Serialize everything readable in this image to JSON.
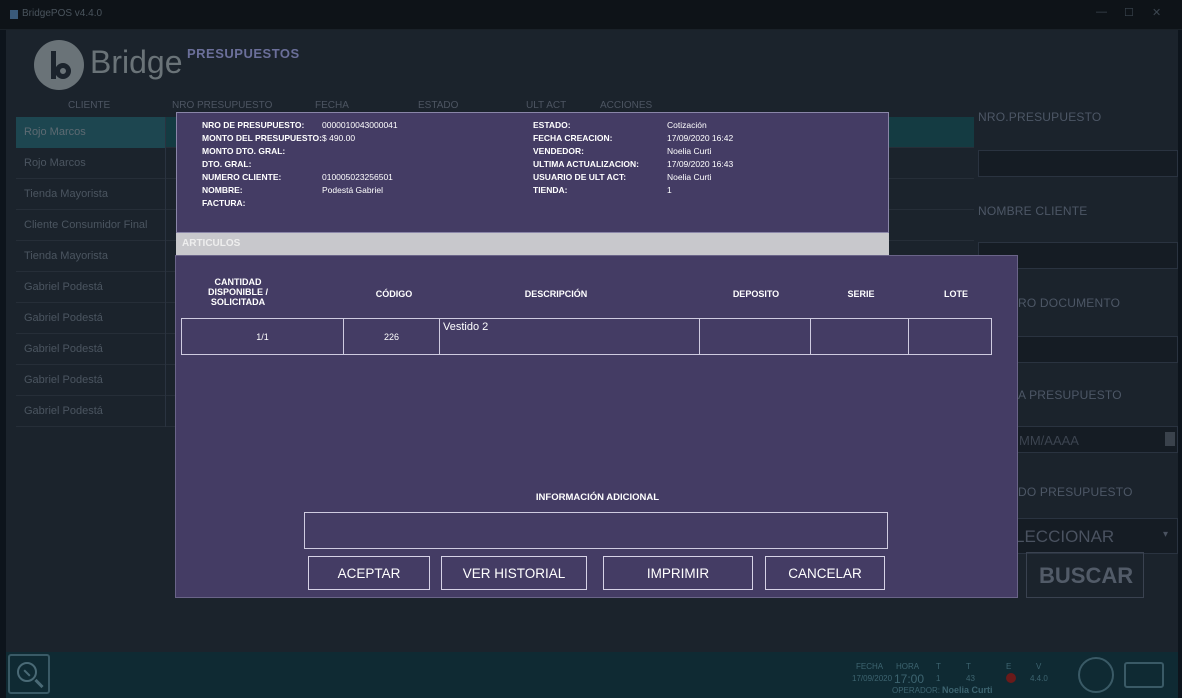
{
  "window": {
    "title": "BridgePOS v4.4.0"
  },
  "brand": {
    "logo_text": "Bridge"
  },
  "page_title": "PRESUPUESTOS",
  "columns": [
    "CLIENTE",
    "NRO PRESUPUESTO",
    "FECHA",
    "ESTADO",
    "ULT ACT",
    "ACCIONES"
  ],
  "rows": [
    "Rojo Marcos",
    "Rojo Marcos",
    "Tienda Mayorista",
    "Cliente Consumidor Final",
    "Tienda Mayorista",
    "Gabriel Podestá",
    "Gabriel Podestá",
    "Gabriel Podestá",
    "Gabriel Podestá",
    "Gabriel Podestá"
  ],
  "right_panel": {
    "nro_presupuesto_label": "NRO.PRESUPUESTO",
    "nombre_cliente_label": "NOMBRE CLIENTE",
    "nro_documento_label": "RO DOCUMENTO",
    "fecha_presupuesto_label": "A PRESUPUESTO",
    "fecha_placeholder": "MM/AAAA",
    "estado_label": "DO PRESUPUESTO",
    "select_value": "LECCIONAR",
    "buscar": "BUSCAR"
  },
  "dialog": {
    "nro_label": "NRO DE PRESUPUESTO:",
    "nro_value": "0000010043000041",
    "monto_label": "MONTO DEL PRESUPUESTO:",
    "monto_value": "$ 490.00",
    "monto_dto_label": "MONTO DTO. GRAL:",
    "dto_label": "DTO. GRAL:",
    "cliente_label": "NUMERO CLIENTE:",
    "cliente_value": "010005023256501",
    "nombre_label": "NOMBRE:",
    "nombre_value": "Podestá Gabriel",
    "factura_label": "FACTURA:",
    "estado_label": "ESTADO:",
    "estado_value": "Cotización",
    "fecha_label": "FECHA CREACION:",
    "fecha_value": "17/09/2020 16:42",
    "vendedor_label": "VENDEDOR:",
    "vendedor_value": "Noelia Curti",
    "ultact_label": "ULTIMA ACTUALIZACION:",
    "ultact_value": "17/09/2020 16:43",
    "usuario_label": "USUARIO DE ULT ACT:",
    "usuario_value": "Noelia Curti",
    "tienda_label": "TIENDA:",
    "tienda_value": "1",
    "articulos_header": "ARTICULOS",
    "table_headers": {
      "cantidad_1": "CANTIDAD",
      "cantidad_2": "DISPONIBLE /",
      "cantidad_3": "SOLICITADA",
      "codigo": "CÓDIGO",
      "descripcion": "DESCRIPCIÓN",
      "deposito": "DEPOSITO",
      "serie": "SERIE",
      "lote": "LOTE"
    },
    "item": {
      "cantidad": "1/1",
      "codigo": "226",
      "descripcion": "Vestido 2",
      "deposito": "",
      "serie": "",
      "lote": ""
    },
    "info_label": "INFORMACIÓN ADICIONAL",
    "buttons": {
      "aceptar": "ACEPTAR",
      "historial": "VER HISTORIAL",
      "imprimir": "IMPRIMIR",
      "cancelar": "CANCELAR"
    }
  },
  "status": {
    "fecha_label": "FECHA",
    "fecha": "17/09/2020",
    "hora_label": "HORA",
    "hora": "17:00",
    "t1_label": "T",
    "t1": "1",
    "t2_label": "T",
    "t2": "43",
    "e_label": "E",
    "v_label": "V",
    "v": "4.4.0",
    "operador_label": "OPERADOR:",
    "operador": "Noelia Curti"
  }
}
